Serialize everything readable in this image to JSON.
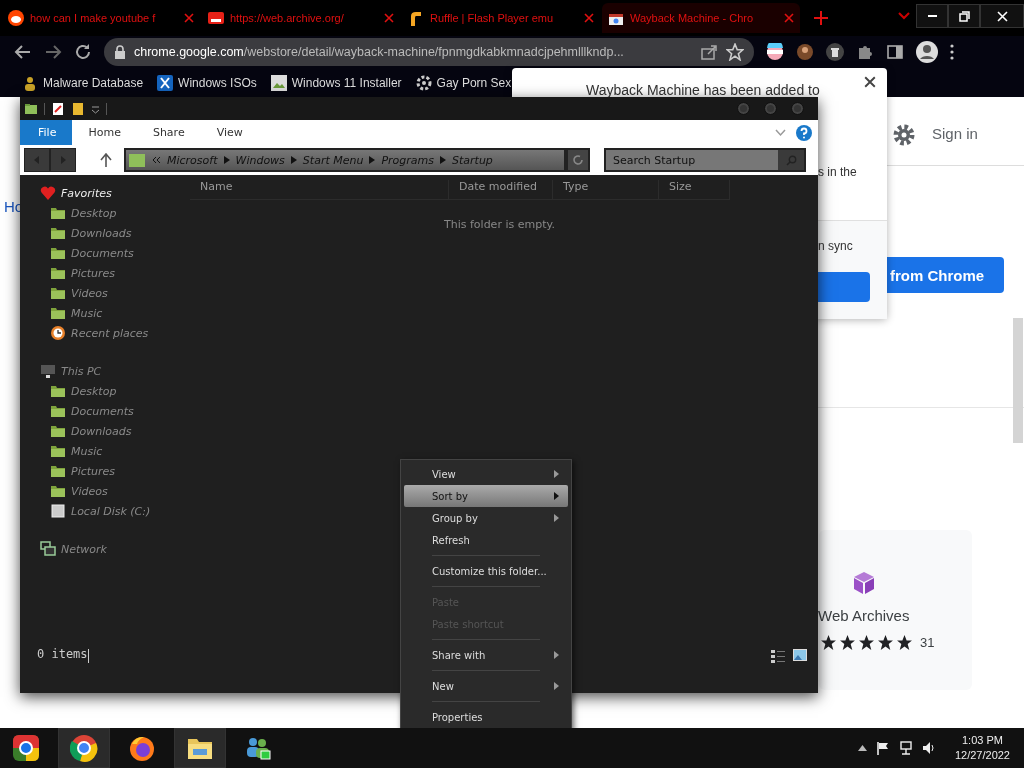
{
  "browser": {
    "tabs": [
      {
        "title": "how can I make youtube f",
        "kind": "reddit",
        "selected": false
      },
      {
        "title": "https://web.archive.org/",
        "kind": "youtube",
        "selected": false
      },
      {
        "title": "Ruffle | Flash Player emu",
        "kind": "ruffle",
        "selected": false
      },
      {
        "title": "Wayback Machine - Chro",
        "kind": "store",
        "selected": true
      }
    ],
    "address": {
      "domain": "chrome.google.com",
      "path": "/webstore/detail/wayback-machine/fpnmgdkabkmnadcjpehmlllkndp..."
    },
    "bookmarks": [
      {
        "label": "Malware Database",
        "kind": "person"
      },
      {
        "label": "Windows ISOs",
        "kind": "x"
      },
      {
        "label": "Windows 11 Installer",
        "kind": "image"
      },
      {
        "label": "Gay Porn Sex",
        "kind": "gear"
      }
    ]
  },
  "page": {
    "home_link": "Ho",
    "sign_in": "Sign in",
    "install_button": "from Chrome",
    "card": {
      "title": "Web Archives",
      "stars": 5,
      "rating_count": "31"
    }
  },
  "popup": {
    "title": "Wayback Machine has been added to",
    "line_2": "s in the",
    "line_3": "n sync"
  },
  "explorer": {
    "ribbon_tabs": [
      {
        "label": "File",
        "kind": "file",
        "selected": false
      },
      {
        "label": "Home",
        "kind": "tab",
        "selected": false
      },
      {
        "label": "Share",
        "kind": "tab",
        "selected": false
      },
      {
        "label": "View",
        "kind": "tab",
        "selected": false
      }
    ],
    "breadcrumb": [
      "Microsoft",
      "Windows",
      "Start Menu",
      "Programs",
      "Startup"
    ],
    "search": {
      "placeholder": "Search Startup"
    },
    "nav": [
      {
        "label": "Favorites",
        "kind": "favorites",
        "children": [
          {
            "label": "Desktop",
            "kind": "folder"
          },
          {
            "label": "Downloads",
            "kind": "folder"
          },
          {
            "label": "Documents",
            "kind": "folder"
          },
          {
            "label": "Pictures",
            "kind": "folder"
          },
          {
            "label": "Videos",
            "kind": "folder"
          },
          {
            "label": "Music",
            "kind": "folder"
          },
          {
            "label": "Recent places",
            "kind": "recent"
          }
        ]
      },
      {
        "label": "This PC",
        "kind": "pc",
        "children": [
          {
            "label": "Desktop",
            "kind": "folder"
          },
          {
            "label": "Documents",
            "kind": "folder"
          },
          {
            "label": "Downloads",
            "kind": "folder"
          },
          {
            "label": "Music",
            "kind": "folder"
          },
          {
            "label": "Pictures",
            "kind": "folder"
          },
          {
            "label": "Videos",
            "kind": "folder"
          },
          {
            "label": "Local Disk (C:)",
            "kind": "disk"
          }
        ]
      },
      {
        "label": "Network",
        "kind": "network"
      }
    ],
    "columns": [
      "Name",
      "Date modified",
      "Type",
      "Size"
    ],
    "empty_message": "This folder is empty.",
    "status": "0 items",
    "context_menu": [
      [
        {
          "label": "View",
          "submenu": true,
          "disabled": false,
          "selected": false
        },
        {
          "label": "Sort by",
          "submenu": true,
          "disabled": false,
          "selected": true
        },
        {
          "label": "Group by",
          "submenu": true,
          "disabled": false,
          "selected": false
        },
        {
          "label": "Refresh",
          "submenu": false,
          "disabled": false,
          "selected": false
        }
      ],
      [
        {
          "label": "Customize this folder...",
          "submenu": false,
          "disabled": false,
          "selected": false
        }
      ],
      [
        {
          "label": "Paste",
          "submenu": false,
          "disabled": true,
          "selected": false
        },
        {
          "label": "Paste shortcut",
          "submenu": false,
          "disabled": true,
          "selected": false
        }
      ],
      [
        {
          "label": "Share with",
          "submenu": true,
          "disabled": false,
          "selected": false
        }
      ],
      [
        {
          "label": "New",
          "submenu": true,
          "disabled": false,
          "selected": false
        }
      ],
      [
        {
          "label": "Properties",
          "submenu": false,
          "disabled": false,
          "selected": false
        }
      ]
    ]
  },
  "taskbar": {
    "apps": [
      {
        "kind": "orb",
        "active": false
      },
      {
        "kind": "chrome",
        "active": true
      },
      {
        "kind": "firefox",
        "active": false
      },
      {
        "kind": "explorer",
        "active": true
      },
      {
        "kind": "messenger",
        "active": false
      }
    ],
    "time": "1:03 PM",
    "date": "12/27/2022"
  }
}
